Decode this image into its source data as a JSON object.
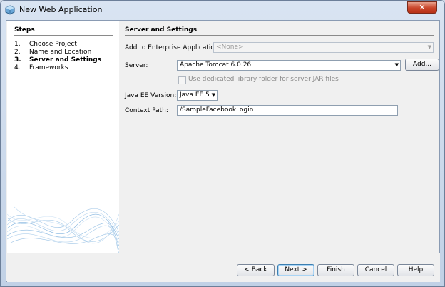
{
  "window": {
    "title": "New Web Application",
    "close_label": "✕"
  },
  "steps": {
    "heading": "Steps",
    "items": [
      {
        "num": "1.",
        "label": "Choose Project"
      },
      {
        "num": "2.",
        "label": "Name and Location"
      },
      {
        "num": "3.",
        "label": "Server and Settings"
      },
      {
        "num": "4.",
        "label": "Frameworks"
      }
    ]
  },
  "panel": {
    "heading": "Server and Settings",
    "enterprise_label": "Add to Enterprise Application:",
    "enterprise_value": "<None>",
    "server_label": "Server:",
    "server_value": "Apache Tomcat 6.0.26",
    "add_label": "Add...",
    "dedicated_label": "Use dedicated library folder for server JAR files",
    "javaee_label": "Java EE Version:",
    "javaee_value": "Java EE 5",
    "context_label": "Context Path:",
    "context_value": "/SampleFacebookLogin"
  },
  "footer": {
    "back": "< Back",
    "next": "Next >",
    "finish": "Finish",
    "cancel": "Cancel",
    "help": "Help"
  },
  "icons": {
    "dropdown": "▼",
    "app": "netbeans-cube"
  }
}
